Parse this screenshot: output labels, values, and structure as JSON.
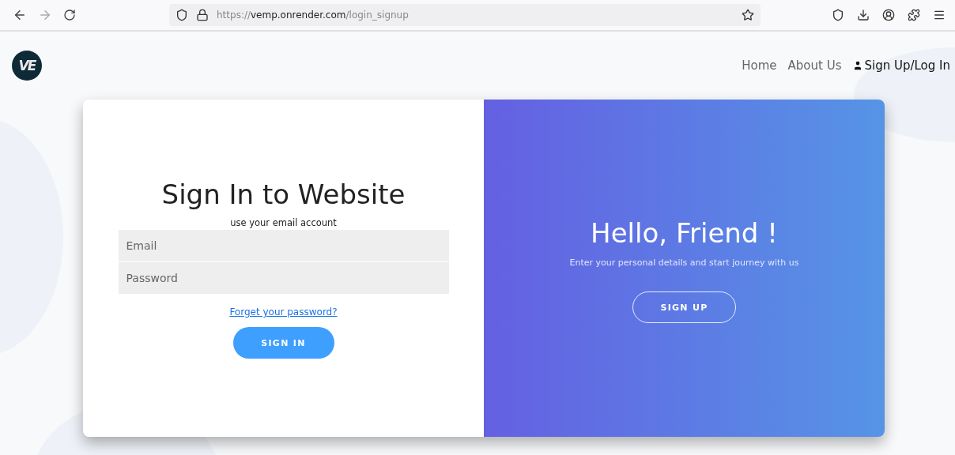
{
  "browser": {
    "url": [
      {
        "text": "https://",
        "kind": "dim"
      },
      {
        "text": "vemp.onrender.com",
        "kind": "main"
      },
      {
        "text": "/login_signup",
        "kind": "dim"
      }
    ]
  },
  "header": {
    "logo": "VE",
    "nav": [
      {
        "label": "Home",
        "kind": "plain"
      },
      {
        "label": "About Us",
        "kind": "plain"
      },
      {
        "label": "Sign Up/Log In",
        "kind": "account"
      }
    ]
  },
  "sign_in": {
    "title": "Sign In to Website",
    "subtitle": "use your email account",
    "fields": [
      {
        "placeholder": "Email"
      },
      {
        "placeholder": "Password"
      }
    ],
    "forgot_link": "Forget your password?",
    "button": "SIGN IN"
  },
  "welcome": {
    "title": "Hello, Friend !",
    "text": "Enter your personal details and start journey with us",
    "button": "SIGN UP"
  }
}
